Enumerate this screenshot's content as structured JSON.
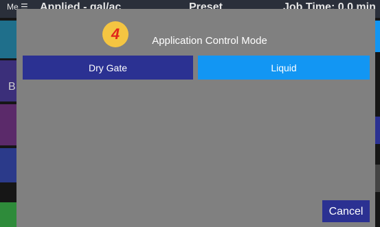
{
  "background": {
    "menu_label": "Me",
    "applied_label": "Applied - gal/ac",
    "preset_label": "Preset",
    "job_time_label": "Job Time: 0.0 min",
    "side_letter": "B"
  },
  "modal": {
    "step_badge": "4",
    "title": "Application Control Mode",
    "options": [
      {
        "label": "Dry Gate",
        "selected": true,
        "color": "#2b3192"
      },
      {
        "label": "Liquid",
        "selected": false,
        "color": "#1296f3"
      }
    ],
    "cancel_label": "Cancel",
    "background_color": "#808080"
  }
}
